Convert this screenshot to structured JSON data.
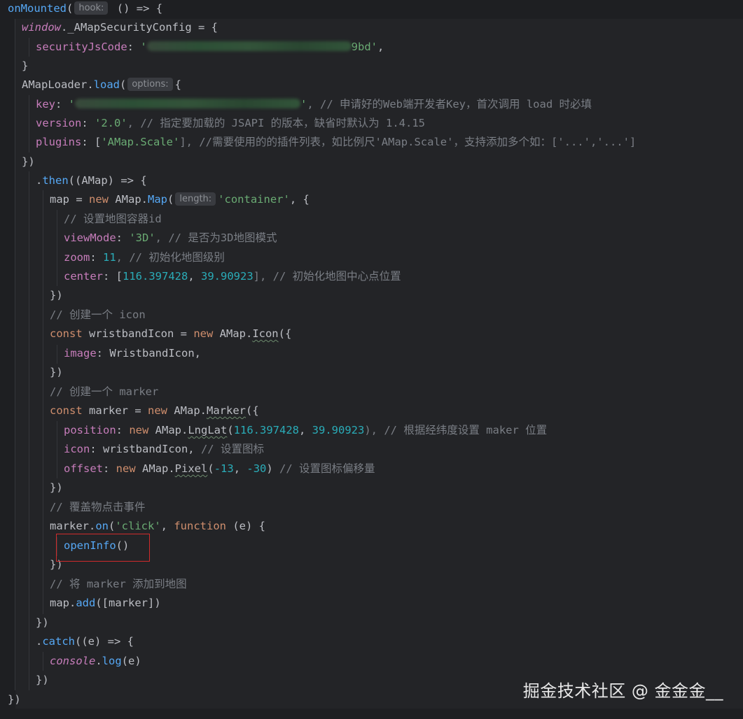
{
  "hints": {
    "hook": "hook:",
    "options": "options:",
    "length": "length:"
  },
  "code": {
    "l1_fn": "onMounted",
    "l1_open": "(",
    "l1_rest": " () => {",
    "l2_window": "window",
    "l2_dot": ".",
    "l2_prop": "_AMapSecurityConfig",
    "l2_rest": " = {",
    "l3_prop": "securityJsCode",
    "l3_colon": ": ",
    "l3_q": "'",
    "l3_tail": "9bd'",
    "l3_comma": ",",
    "l4": "}",
    "l5_obj": "AMapLoader",
    "l5_dot": ".",
    "l5_fn": "load",
    "l5_open": "(",
    "l5_brace": "{",
    "l6_prop": "key",
    "l6_colon": ": ",
    "l6_q": "'",
    "l6_tail": "'",
    "l6_comment": ", // 申请好的Web端开发者Key，首次调用 load 时必填",
    "l7_prop": "version",
    "l7_colon": ": ",
    "l7_str": "'2.0'",
    "l7_comment": ", // 指定要加载的 JSAPI 的版本，缺省时默认为 1.4.15",
    "l8_prop": "plugins",
    "l8_colon": ": [",
    "l8_str": "'AMap.Scale'",
    "l8_comment": "], //需要使用的的插件列表，如比例尺'AMap.Scale'，支持添加多个如：['...','...']",
    "l9": "})",
    "l10_dot": ".",
    "l10_fn": "then",
    "l10_rest": "((AMap) => {",
    "l11_a": "map = ",
    "l11_new": "new",
    "l11_b": " AMap.",
    "l11_fn": "Map",
    "l11_open": "(",
    "l11_str": "'container'",
    "l11_rest": ", {",
    "l12": "// 设置地图容器id",
    "l13_prop": "viewMode",
    "l13_colon": ": ",
    "l13_str": "'3D'",
    "l13_comment": ", // 是否为3D地图模式",
    "l14_prop": "zoom",
    "l14_colon": ": ",
    "l14_num": "11",
    "l14_comment": ", // 初始化地图级别",
    "l15_prop": "center",
    "l15_colon": ": [",
    "l15_n1": "116.397428",
    "l15_sep": ", ",
    "l15_n2": "39.90923",
    "l15_comment": "], // 初始化地图中心点位置",
    "l16": "})",
    "l17": "// 创建一个 icon",
    "l18_const": "const",
    "l18_a": " wristbandIcon = ",
    "l18_new": "new",
    "l18_b": " AMap.",
    "l18_cls": "Icon",
    "l18_rest": "({",
    "l19_prop": "image",
    "l19_rest": ": WristbandIcon,",
    "l20": "})",
    "l21": "// 创建一个 marker",
    "l22_const": "const",
    "l22_a": " marker = ",
    "l22_new": "new",
    "l22_b": " AMap.",
    "l22_cls": "Marker",
    "l22_rest": "({",
    "l23_prop": "position",
    "l23_colon": ": ",
    "l23_new": "new",
    "l23_b": " AMap.",
    "l23_cls": "LngLat",
    "l23_open": "(",
    "l23_n1": "116.397428",
    "l23_sep": ", ",
    "l23_n2": "39.90923",
    "l23_comment": "), // 根据经纬度设置 maker 位置",
    "l24_prop": "icon",
    "l24_rest": ": wristbandIcon, ",
    "l24_comment": "// 设置图标",
    "l25_prop": "offset",
    "l25_colon": ": ",
    "l25_new": "new",
    "l25_b": " AMap.",
    "l25_cls": "Pixel",
    "l25_open": "(",
    "l25_n1": "-13",
    "l25_sep": ", ",
    "l25_n2": "-30",
    "l25_close": ") ",
    "l25_comment": "// 设置图标偏移量",
    "l26": "})",
    "l27": "// 覆盖物点击事件",
    "l28_a": "marker.",
    "l28_fn": "on",
    "l28_open": "(",
    "l28_str": "'click'",
    "l28_sep": ", ",
    "l28_kw": "function",
    "l28_rest": " (e) {",
    "l29_fn": "openInfo",
    "l29_rest": "()",
    "l30": "})",
    "l31": "// 将 marker 添加到地图",
    "l32_a": "map.",
    "l32_fn": "add",
    "l32_rest": "([marker])",
    "l33": "})",
    "l34_dot": ".",
    "l34_fn": "catch",
    "l34_rest": "((e) => {",
    "l35_obj": "console",
    "l35_dot": ".",
    "l35_fn": "log",
    "l35_rest": "(e)",
    "l36": "})",
    "l37": "})"
  },
  "watermark": "掘金技术社区 @ 金金金__"
}
